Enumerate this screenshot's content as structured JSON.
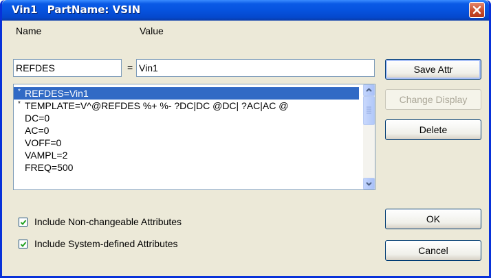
{
  "window": {
    "title_ref": "Vin1",
    "title_part": "PartName: VSIN"
  },
  "labels": {
    "name": "Name",
    "value": "Value",
    "equals": "="
  },
  "fields": {
    "name_value": "REFDES",
    "value_value": "Vin1"
  },
  "attributes": [
    {
      "text": "REFDES=Vin1",
      "marker": "*",
      "selected": true
    },
    {
      "text": "TEMPLATE=V^@REFDES %+ %- ?DC|DC @DC| ?AC|AC @",
      "marker": "*",
      "selected": false
    },
    {
      "text": "DC=0",
      "marker": "",
      "selected": false
    },
    {
      "text": "AC=0",
      "marker": "",
      "selected": false
    },
    {
      "text": "VOFF=0",
      "marker": "",
      "selected": false
    },
    {
      "text": "VAMPL=2",
      "marker": "",
      "selected": false
    },
    {
      "text": "FREQ=500",
      "marker": "",
      "selected": false
    }
  ],
  "buttons": {
    "save_attr": "Save Attr",
    "change_display": "Change Display",
    "delete": "Delete",
    "ok": "OK",
    "cancel": "Cancel"
  },
  "checkboxes": {
    "non_changeable": "Include Non-changeable Attributes",
    "system_defined": "Include System-defined Attributes",
    "non_changeable_checked": true,
    "system_defined_checked": true
  },
  "colors": {
    "title_bar": "#0653df",
    "selection": "#316ac5",
    "close_button": "#c74a2a"
  }
}
